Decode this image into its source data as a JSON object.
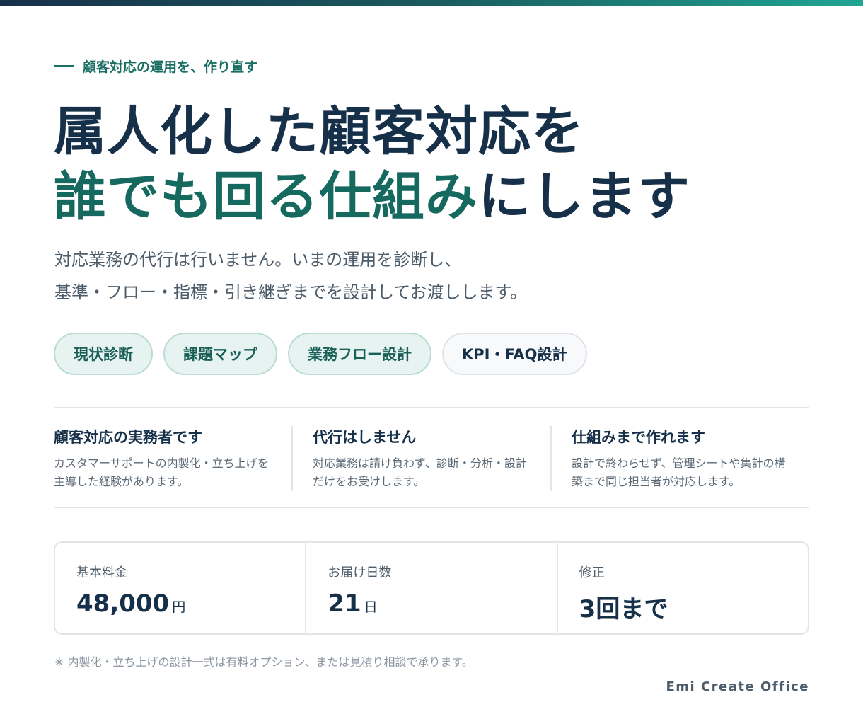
{
  "eyebrow": "顧客対応の運用を、作り直す",
  "headline": {
    "line1": "属人化した顧客対応を",
    "line2_accent": "誰でも回る仕組み",
    "line2_rest": "にします"
  },
  "lead": {
    "line1": "対応業務の代行は行いません。いまの運用を診断し、",
    "line2": "基準・フロー・指標・引き継ぎまでを設計してお渡しします。"
  },
  "tags": [
    "現状診断",
    "課題マップ",
    "業務フロー設計",
    "KPI・FAQ設計"
  ],
  "features": [
    {
      "title": "顧客対応の実務者です",
      "desc1": "カスタマーサポートの内製化・立ち上げを",
      "desc2": "主導した経験があります。"
    },
    {
      "title": "代行はしません",
      "desc1": "対応業務は請け負わず、診断・分析・設計",
      "desc2": "だけをお受けします。"
    },
    {
      "title": "仕組みまで作れます",
      "desc1": "設計で終わらせず、管理シートや集計の構",
      "desc2": "築まで同じ担当者が対応します。"
    }
  ],
  "pricing": [
    {
      "label": "基本料金",
      "value": "48,000",
      "unit": "円"
    },
    {
      "label": "お届け日数",
      "value": "21",
      "unit": "日"
    },
    {
      "label": "修正",
      "value": "3回まで",
      "unit": ""
    }
  ],
  "note": "※ 内製化・立ち上げの設計一式は有料オプション、または見積り相談で承ります。",
  "brand": "Emi Create Office",
  "colors": {
    "navy": "#17304a",
    "teal": "#15695f",
    "tag_bg": "#e6f3f0"
  }
}
